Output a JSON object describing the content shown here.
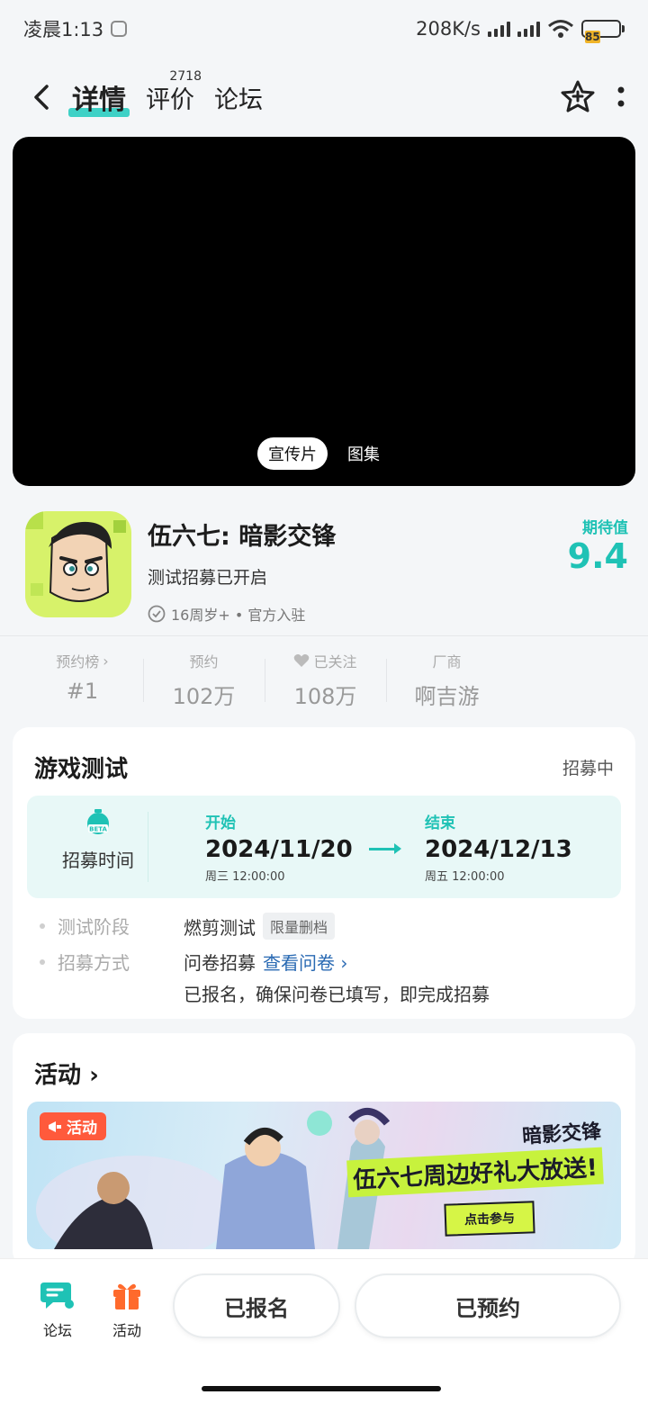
{
  "status_bar": {
    "time": "凌晨1:13",
    "speed": "208K/s",
    "battery": "85"
  },
  "nav": {
    "tab_details": "详情",
    "tab_reviews": "评价",
    "reviews_count": "2718",
    "tab_forum": "论坛"
  },
  "video": {
    "tab_trailer": "宣传片",
    "tab_gallery": "图集"
  },
  "game": {
    "title": "伍六七: 暗影交锋",
    "status": "测试招募已开启",
    "tags": "16周岁+ • 官方入驻",
    "expect_label": "期待值",
    "expect_score": "9.4"
  },
  "stats": [
    {
      "label": "预约榜",
      "value": "#1"
    },
    {
      "label": "预约",
      "value": "102万"
    },
    {
      "label": "已关注",
      "value": "108万"
    },
    {
      "label": "厂商",
      "value": "啊吉游"
    }
  ],
  "test_card": {
    "title": "游戏测试",
    "status": "招募中",
    "recruit_label": "招募时间",
    "start_label": "开始",
    "start_date": "2024/11/20",
    "start_sub": "周三  12:00:00",
    "end_label": "结束",
    "end_date": "2024/12/13",
    "end_sub": "周五  12:00:00",
    "stage_key": "测试阶段",
    "stage_val": "燃剪测试",
    "stage_tag": "限量删档",
    "method_key": "招募方式",
    "method_val": "问卷招募",
    "method_link": "查看问卷",
    "method_note": "已报名，确保问卷已填写，即完成招募"
  },
  "activity": {
    "title": "活动",
    "badge": "活动",
    "brand": "暗影交锋",
    "headline": "伍六七周边好礼大放送!",
    "cta": "点击参与"
  },
  "bottom_bar": {
    "forum": "论坛",
    "activity": "活动",
    "signed_up": "已报名",
    "reserved": "已预约"
  },
  "colors": {
    "accent": "#1fc2b5",
    "link": "#2a6ab3",
    "activity_orange": "#ff6a2c"
  }
}
